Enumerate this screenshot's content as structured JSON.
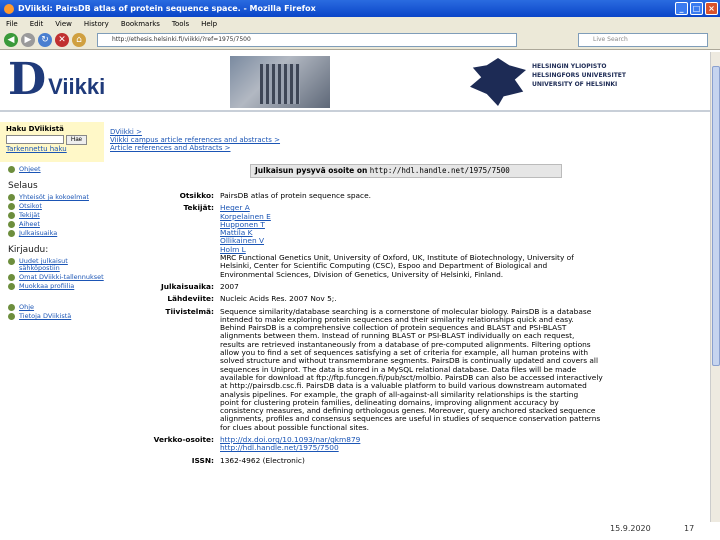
{
  "window": {
    "title": "DViikki: PairsDB atlas of protein sequence space. - Mozilla Firefox",
    "min": "_",
    "max": "□",
    "close": "×"
  },
  "menu": [
    "File",
    "Edit",
    "View",
    "History",
    "Bookmarks",
    "Tools",
    "Help"
  ],
  "toolbar": {
    "url": "http://ethesis.helsinki.fi/viikki/?ref=1975/7500",
    "search_placeholder": "Live Search"
  },
  "banner": {
    "logo_letter": "D",
    "logo_text": "Viikki",
    "uni_names": [
      "HELSINGIN YLIOPISTO",
      "HELSINGFORS UNIVERSITET",
      "UNIVERSITY OF HELSINKI"
    ]
  },
  "sidebar": {
    "search_head": "Haku DViikistä",
    "search_button": "Hae",
    "advanced_link": "Tarkennettu haku",
    "help_link": "Ohjeet",
    "browse_head": "Selaus",
    "browse_items": [
      "Yhteisöt ja kokoelmat",
      "Otsikot",
      "Tekijät",
      "Aiheet",
      "Julkaisuaika"
    ],
    "login_head": "Kirjaudu:",
    "login_items": [
      "Uudet julkaisut sähköpostiin",
      "Omat DViikki-tallennukset",
      "Muokkaa profiilia"
    ],
    "other_items": [
      "Ohje",
      "Tietoja DViikistä"
    ]
  },
  "content": {
    "crumbs": [
      "DViikki >",
      "Viikki campus article references and abstracts >",
      "Article references and Abstracts >"
    ],
    "permalink_label": "Julkaisun pysyvä osoite on",
    "permalink_url": "http://hdl.handle.net/1975/7500",
    "fields": {
      "title_label": "Otsikko:",
      "title": "PairsDB atlas of protein sequence space.",
      "authors_label": "Tekijät:",
      "authors": [
        "Heger A",
        "Korpelainen E",
        "Hupponen T",
        "Mattila K",
        "Ollikainen V",
        "Holm L"
      ],
      "affiliation": [
        "MRC Functional Genetics Unit, University of Oxford, UK, Institute of Biotechnology, University of",
        "Helsinki, Center for Scientific Computing (CSC), Espoo and Department of Biological and",
        "Environmental Sciences, Division of Genetics, University of Helsinki, Finland."
      ],
      "date_label": "Julkaisuaika:",
      "date": "2007",
      "source_label": "Lähdeviite:",
      "source": "Nucleic Acids Res. 2007 Nov 5;.",
      "abstract_label": "Tiivistelmä:",
      "abstract": [
        "Sequence similarity/database searching is a cornerstone of molecular biology. PairsDB is a database",
        "intended to make exploring protein sequences and their similarity relationships quick and easy.",
        "Behind PairsDB is a comprehensive collection of protein sequences and BLAST and PSI-BLAST",
        "alignments between them. Instead of running BLAST or PSI-BLAST individually on each request,",
        "results are retrieved instantaneously from a database of pre-computed alignments. Filtering options",
        "allow you to find a set of sequences satisfying a set of criteria for example, all human proteins with",
        "solved structure and without transmembrane segments. PairsDB is continually updated and covers all",
        "sequences in Uniprot. The data is stored in a MySQL relational database. Data files will be made",
        "available for download at ftp://ftp.funcgen.fi/pub/sct/molbio. PairsDB can also be accessed interactively",
        "at http://pairsdb.csc.fi. PairsDB data is a valuable platform to build various downstream automated",
        "analysis pipelines. For example, the graph of all-against-all similarity relationships is the starting",
        "point for clustering protein families, delineating domains, improving alignment accuracy by",
        "consistency measures, and defining orthologous genes. Moreover, query anchored stacked sequence",
        "alignments, profiles and consensus sequences are useful in studies of sequence conservation patterns",
        "for clues about possible functional sites."
      ],
      "url_label": "Verkko-osoite:",
      "urls": [
        "http://dx.doi.org/10.1093/nar/gkm879",
        "http://hdl.handle.net/1975/7500"
      ],
      "issn_label": "ISSN:",
      "issn": "1362-4962 (Electronic)"
    }
  },
  "slide_footer": {
    "date": "15.9.2020",
    "page": "17"
  }
}
